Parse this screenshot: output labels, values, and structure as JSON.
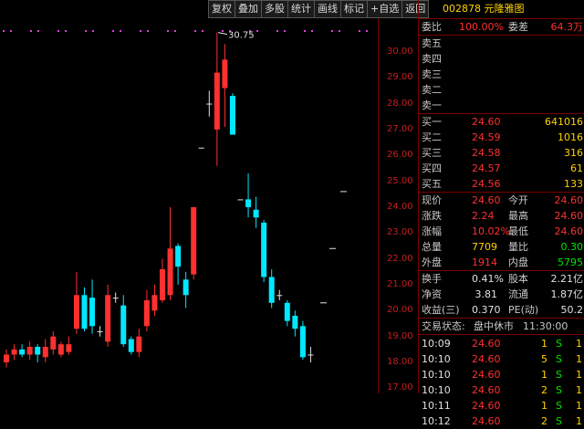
{
  "toolbar": [
    "复权",
    "叠加",
    "多股",
    "统计",
    "画线",
    "标记",
    "+自选",
    "返回"
  ],
  "stock": {
    "code": "002878",
    "name": "元隆雅图"
  },
  "commission": {
    "ratio_label": "委比",
    "ratio": "100.00%",
    "diff_label": "委差",
    "diff": "64.3万"
  },
  "asks": [
    {
      "label": "卖五",
      "price": "",
      "vol": ""
    },
    {
      "label": "卖四",
      "price": "",
      "vol": ""
    },
    {
      "label": "卖三",
      "price": "",
      "vol": ""
    },
    {
      "label": "卖二",
      "price": "",
      "vol": ""
    },
    {
      "label": "卖一",
      "price": "",
      "vol": ""
    }
  ],
  "bids": [
    {
      "label": "买一",
      "price": "24.60",
      "vol": "641016"
    },
    {
      "label": "买二",
      "price": "24.59",
      "vol": "1016"
    },
    {
      "label": "买三",
      "price": "24.58",
      "vol": "316"
    },
    {
      "label": "买四",
      "price": "24.57",
      "vol": "61"
    },
    {
      "label": "买五",
      "price": "24.56",
      "vol": "133"
    }
  ],
  "quote": [
    {
      "l1": "现价",
      "v1": "24.60",
      "l2": "今开",
      "v2": "24.60"
    },
    {
      "l1": "涨跌",
      "v1": "2.24",
      "l2": "最高",
      "v2": "24.60"
    },
    {
      "l1": "涨幅",
      "v1": "10.02%",
      "l2": "最低",
      "v2": "24.60"
    },
    {
      "l1": "总量",
      "v1": "7709",
      "l2": "量比",
      "v2": "0.30"
    },
    {
      "l1": "外盘",
      "v1": "1914",
      "l2": "内盘",
      "v2": "5795"
    }
  ],
  "finance": [
    {
      "l1": "换手",
      "v1": "0.41%",
      "l2": "股本",
      "v2": "2.21亿"
    },
    {
      "l1": "净资",
      "v1": "3.81",
      "l2": "流通",
      "v2": "1.87亿"
    },
    {
      "l1": "收益(三)",
      "v1": "0.370",
      "l2": "PE(动)",
      "v2": "50.2"
    }
  ],
  "trade_status": {
    "label": "交易状态:",
    "state": "盘中休市",
    "time": "11:30:00"
  },
  "ticks_list": [
    {
      "time": "10:09",
      "price": "24.60",
      "vol": "1",
      "side": "S",
      "n": "1"
    },
    {
      "time": "10:10",
      "price": "24.60",
      "vol": "5",
      "side": "S",
      "n": "1"
    },
    {
      "time": "10:10",
      "price": "24.60",
      "vol": "1",
      "side": "S",
      "n": "1"
    },
    {
      "time": "10:10",
      "price": "24.60",
      "vol": "2",
      "side": "S",
      "n": "1"
    },
    {
      "time": "10:11",
      "price": "24.60",
      "vol": "1",
      "side": "S",
      "n": "1"
    },
    {
      "time": "10:12",
      "price": "24.60",
      "vol": "2",
      "side": "S",
      "n": "1"
    }
  ],
  "colors": {
    "up": "#ff3030",
    "down": "#00e8ff",
    "panel_border": "#7a0000",
    "label": "#c8c8c8"
  },
  "chart_data": {
    "type": "candlestick",
    "y_ticks": [
      "30.00",
      "29.00",
      "28.00",
      "27.00",
      "26.00",
      "25.00",
      "24.00",
      "23.00",
      "22.00",
      "21.00",
      "20.00",
      "19.00",
      "18.00",
      "17.00"
    ],
    "ylim": [
      16.8,
      31.3
    ],
    "high_annotation": "30.75",
    "candles": [
      {
        "o": 18.0,
        "c": 18.3,
        "h": 18.5,
        "l": 17.8
      },
      {
        "o": 18.3,
        "c": 18.5,
        "h": 18.7,
        "l": 18.1
      },
      {
        "o": 18.5,
        "c": 18.3,
        "h": 18.7,
        "l": 18.2
      },
      {
        "o": 18.3,
        "c": 18.6,
        "h": 18.8,
        "l": 18.1
      },
      {
        "o": 18.6,
        "c": 18.3,
        "h": 18.7,
        "l": 18.0
      },
      {
        "o": 18.2,
        "c": 18.6,
        "h": 18.9,
        "l": 18.0
      },
      {
        "o": 18.5,
        "c": 19.0,
        "h": 19.2,
        "l": 18.3
      },
      {
        "o": 18.3,
        "c": 18.7,
        "h": 18.8,
        "l": 18.2
      },
      {
        "o": 18.4,
        "c": 18.7,
        "h": 19.0,
        "l": 18.3
      },
      {
        "o": 19.3,
        "c": 20.6,
        "h": 21.5,
        "l": 19.1
      },
      {
        "o": 20.6,
        "c": 19.3,
        "h": 20.9,
        "l": 19.2
      },
      {
        "o": 20.5,
        "c": 19.4,
        "h": 21.2,
        "l": 19.1
      },
      {
        "o": 19.2,
        "c": 19.2,
        "h": 19.4,
        "l": 19.0
      },
      {
        "o": 18.8,
        "c": 20.6,
        "h": 21.0,
        "l": 18.6
      },
      {
        "o": 20.5,
        "c": 20.5,
        "h": 20.7,
        "l": 20.3
      },
      {
        "o": 20.2,
        "c": 18.7,
        "h": 20.6,
        "l": 18.6
      },
      {
        "o": 18.9,
        "c": 18.4,
        "h": 19.0,
        "l": 18.3
      },
      {
        "o": 18.4,
        "c": 19.0,
        "h": 19.3,
        "l": 18.2
      },
      {
        "o": 19.4,
        "c": 20.4,
        "h": 20.8,
        "l": 19.2
      },
      {
        "o": 20.0,
        "c": 20.6,
        "h": 21.0,
        "l": 19.8
      },
      {
        "o": 20.4,
        "c": 21.6,
        "h": 22.0,
        "l": 20.3
      },
      {
        "o": 20.6,
        "c": 22.4,
        "h": 24.0,
        "l": 20.4
      },
      {
        "o": 22.5,
        "c": 21.7,
        "h": 22.6,
        "l": 21.0
      },
      {
        "o": 21.2,
        "c": 20.6,
        "h": 21.5,
        "l": 20.1
      },
      {
        "o": 21.4,
        "c": 24.0,
        "h": 24.0,
        "l": 21.2
      },
      {
        "o": 26.3,
        "c": 26.3,
        "h": 26.3,
        "l": 26.3
      },
      {
        "o": 28.0,
        "c": 28.0,
        "h": 28.5,
        "l": 27.5
      },
      {
        "o": 27.0,
        "c": 29.2,
        "h": 30.75,
        "l": 25.6
      },
      {
        "o": 28.6,
        "c": 29.7,
        "h": 30.3,
        "l": 27.1
      },
      {
        "o": 28.3,
        "c": 26.8,
        "h": 28.4,
        "l": 26.8
      },
      {
        "o": 24.3,
        "c": 24.3,
        "h": 24.3,
        "l": 24.3
      },
      {
        "o": 24.3,
        "c": 24.0,
        "h": 25.3,
        "l": 23.6
      },
      {
        "o": 23.9,
        "c": 23.6,
        "h": 24.4,
        "l": 23.2
      },
      {
        "o": 23.4,
        "c": 21.3,
        "h": 23.5,
        "l": 21.1
      },
      {
        "o": 21.3,
        "c": 20.3,
        "h": 21.6,
        "l": 20.1
      },
      {
        "o": 20.6,
        "c": 20.6,
        "h": 20.8,
        "l": 20.4
      },
      {
        "o": 20.3,
        "c": 19.6,
        "h": 20.4,
        "l": 19.4
      },
      {
        "o": 19.8,
        "c": 19.3,
        "h": 20.0,
        "l": 19.0
      },
      {
        "o": 19.4,
        "c": 18.2,
        "h": 19.6,
        "l": 18.1
      },
      {
        "o": 18.3,
        "c": 18.3,
        "h": 18.6,
        "l": 18.0
      }
    ]
  }
}
